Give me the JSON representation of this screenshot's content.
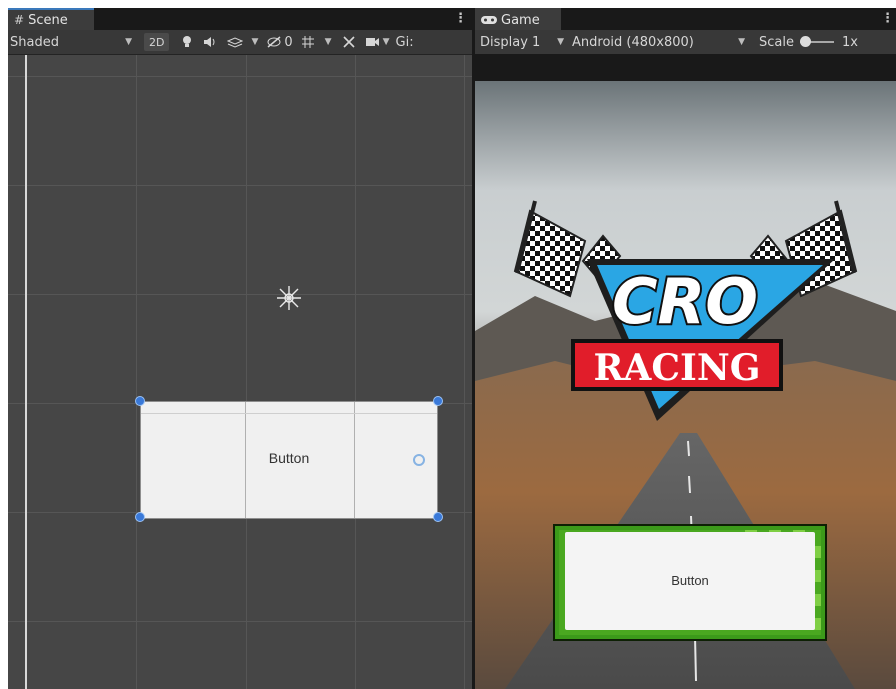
{
  "scene": {
    "tab_label": "Scene",
    "shading_mode": "Shaded",
    "toggle_2d": "2D",
    "hidden_count": "0",
    "gizmos_label": "Gi:",
    "button_text": "Button"
  },
  "game": {
    "tab_label": "Game",
    "display": "Display 1",
    "resolution": "Android (480x800)",
    "scale_label": "Scale",
    "scale_value": "1x",
    "scale_fraction": 0.0,
    "button_text": "Button",
    "logo": {
      "main_text": "CRO",
      "sub_text": "RACING"
    }
  },
  "colors": {
    "accent": "#3a79bb",
    "logo_blue": "#2aa6e4",
    "logo_red": "#e11d2a",
    "button_green": "#3c9a1a"
  }
}
